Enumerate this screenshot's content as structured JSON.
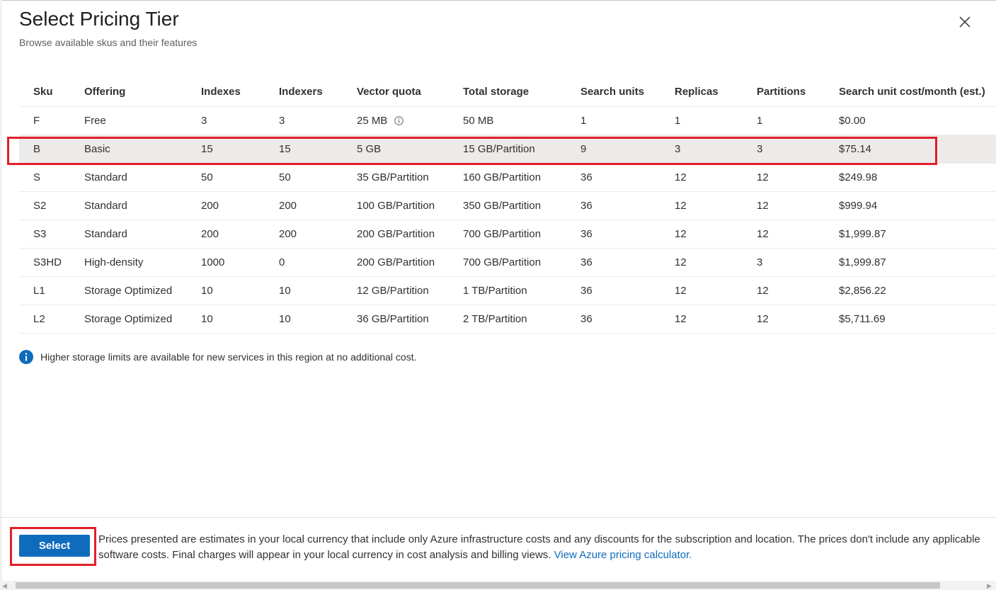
{
  "header": {
    "title": "Select Pricing Tier",
    "subtitle": "Browse available skus and their features"
  },
  "table": {
    "columns": [
      "Sku",
      "Offering",
      "Indexes",
      "Indexers",
      "Vector quota",
      "Total storage",
      "Search units",
      "Replicas",
      "Partitions",
      "Search unit cost/month (est.)"
    ],
    "selected_row": 1,
    "rows": [
      [
        "F",
        "Free",
        "3",
        "3",
        "25 MB",
        "50 MB",
        "1",
        "1",
        "1",
        "$0.00"
      ],
      [
        "B",
        "Basic",
        "15",
        "15",
        "5 GB",
        "15 GB/Partition",
        "9",
        "3",
        "3",
        "$75.14"
      ],
      [
        "S",
        "Standard",
        "50",
        "50",
        "35 GB/Partition",
        "160 GB/Partition",
        "36",
        "12",
        "12",
        "$249.98"
      ],
      [
        "S2",
        "Standard",
        "200",
        "200",
        "100 GB/Partition",
        "350 GB/Partition",
        "36",
        "12",
        "12",
        "$999.94"
      ],
      [
        "S3",
        "Standard",
        "200",
        "200",
        "200 GB/Partition",
        "700 GB/Partition",
        "36",
        "12",
        "12",
        "$1,999.87"
      ],
      [
        "S3HD",
        "High-density",
        "1000",
        "0",
        "200 GB/Partition",
        "700 GB/Partition",
        "36",
        "12",
        "3",
        "$1,999.87"
      ],
      [
        "L1",
        "Storage Optimized",
        "10",
        "10",
        "12 GB/Partition",
        "1 TB/Partition",
        "36",
        "12",
        "12",
        "$2,856.22"
      ],
      [
        "L2",
        "Storage Optimized",
        "10",
        "10",
        "36 GB/Partition",
        "2 TB/Partition",
        "36",
        "12",
        "12",
        "$5,711.69"
      ]
    ]
  },
  "note": {
    "icon": "info-icon",
    "text": "Higher storage limits are available for new services in this region at no additional cost."
  },
  "footer": {
    "select_label": "Select",
    "disclaimer": "Prices presented are estimates in your local currency that include only Azure infrastructure costs and any discounts for the subscription and location. The prices don't include any applicable software costs. Final charges will appear in your local currency in cost analysis and billing views. ",
    "link_text": "View Azure pricing calculator."
  },
  "colors": {
    "accent": "#0f6cbd",
    "highlight": "#e21e2a",
    "selected_row_bg": "#edebe9"
  }
}
